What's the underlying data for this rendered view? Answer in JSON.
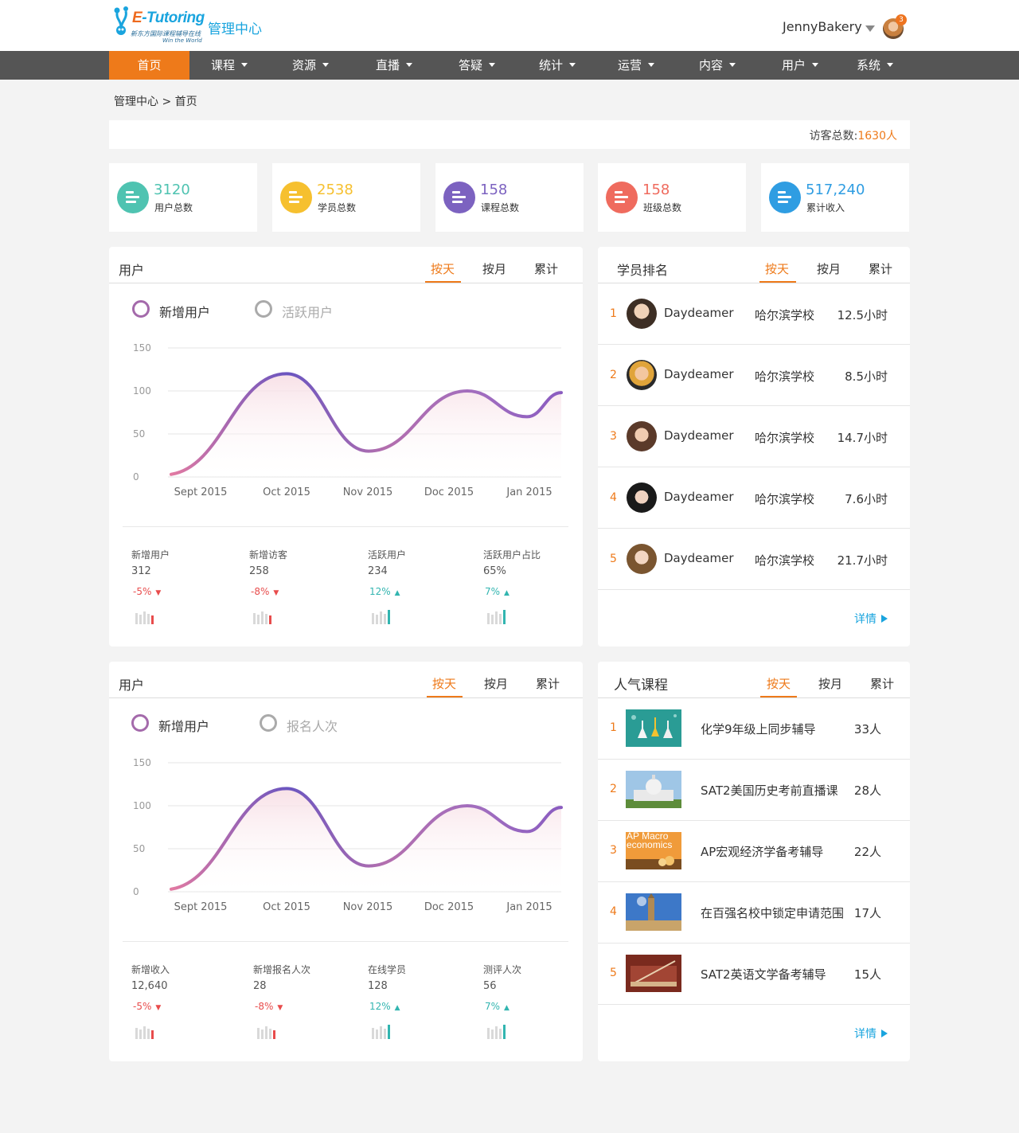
{
  "brand": {
    "name": "E-Tutoring",
    "tagline": "新东方国际课程辅导在线",
    "slogan": "Win the World",
    "center": "管理中心"
  },
  "user": {
    "name": "JennyBakery",
    "notifications": "3"
  },
  "nav": [
    "首页",
    "课程",
    "资源",
    "直播",
    "答疑",
    "统计",
    "运营",
    "内容",
    "用户",
    "系统"
  ],
  "breadcrumb": "管理中心 > 首页",
  "visitors": {
    "label": "访客总数:",
    "value": "1630人"
  },
  "stats": [
    {
      "value": "3120",
      "label": "用户总数",
      "color": "#4fc3b1"
    },
    {
      "value": "2538",
      "label": "学员总数",
      "color": "#f6c02f"
    },
    {
      "value": "158",
      "label": "课程总数",
      "color": "#7c62c0"
    },
    {
      "value": "158",
      "label": "班级总数",
      "color": "#ef6b5e"
    },
    {
      "value": "517,240",
      "label": "累计收入",
      "color": "#2f9de2"
    }
  ],
  "tabs": [
    "按天",
    "按月",
    "累计"
  ],
  "panel_user": {
    "title": "用户",
    "legend": [
      "新增用户",
      "活跃用户"
    ],
    "metrics": [
      {
        "label": "新增用户",
        "value": "312",
        "change": "-5%",
        "direction": "down"
      },
      {
        "label": "新增访客",
        "value": "258",
        "change": "-8%",
        "direction": "down"
      },
      {
        "label": "活跃用户",
        "value": "234",
        "change": "12%",
        "direction": "up"
      },
      {
        "label": "活跃用户占比",
        "value": "65%",
        "change": "7%",
        "direction": "up"
      }
    ]
  },
  "panel_signup": {
    "title": "用户",
    "legend": [
      "新增用户",
      "报名人次"
    ],
    "metrics": [
      {
        "label": "新增收入",
        "value": "12,640",
        "change": "-5%",
        "direction": "down"
      },
      {
        "label": "新增报名人次",
        "value": "28",
        "change": "-8%",
        "direction": "down"
      },
      {
        "label": "在线学员",
        "value": "128",
        "change": "12%",
        "direction": "up"
      },
      {
        "label": "测评人次",
        "value": "56",
        "change": "7%",
        "direction": "up"
      }
    ]
  },
  "ranking": {
    "title": "学员排名",
    "rows": [
      {
        "rank": "1",
        "name": "Daydeamer",
        "school": "哈尔滨学校",
        "hours": "12.5小时"
      },
      {
        "rank": "2",
        "name": "Daydeamer",
        "school": "哈尔滨学校",
        "hours": "8.5小时"
      },
      {
        "rank": "3",
        "name": "Daydeamer",
        "school": "哈尔滨学校",
        "hours": "14.7小时"
      },
      {
        "rank": "4",
        "name": "Daydeamer",
        "school": "哈尔滨学校",
        "hours": "7.6小时"
      },
      {
        "rank": "5",
        "name": "Daydeamer",
        "school": "哈尔滨学校",
        "hours": "21.7小时"
      }
    ],
    "details": "详情"
  },
  "courses": {
    "title": "人气课程",
    "rows": [
      {
        "rank": "1",
        "title": "化学9年级上同步辅导",
        "count": "33人"
      },
      {
        "rank": "2",
        "title": "SAT2美国历史考前直播课",
        "count": "28人"
      },
      {
        "rank": "3",
        "title": "AP宏观经济学备考辅导",
        "count": "22人"
      },
      {
        "rank": "4",
        "title": "在百强名校中锁定申请范围",
        "count": "17人"
      },
      {
        "rank": "5",
        "title": "SAT2英语文学备考辅导",
        "count": "15人"
      }
    ],
    "thumb3_text": "AP Macro economics",
    "details": "详情"
  },
  "chart_data": [
    {
      "type": "area",
      "x": [
        "Sept 2015",
        "Oct 2015",
        "Nov 2015",
        "Doc 2015",
        "Jan 2015"
      ],
      "yticks": [
        "0",
        "50",
        "100",
        "150"
      ],
      "ylim": [
        0,
        150
      ],
      "series": [
        {
          "name": "新增用户",
          "values": [
            22,
            120,
            30,
            100,
            98
          ]
        }
      ],
      "legend": "top-left"
    },
    {
      "type": "area",
      "x": [
        "Sept 2015",
        "Oct 2015",
        "Nov 2015",
        "Doc 2015",
        "Jan 2015"
      ],
      "yticks": [
        "0",
        "50",
        "100",
        "150"
      ],
      "ylim": [
        0,
        150
      ],
      "series": [
        {
          "name": "新增用户",
          "values": [
            22,
            120,
            30,
            100,
            98
          ]
        }
      ],
      "legend": "top-left"
    }
  ]
}
